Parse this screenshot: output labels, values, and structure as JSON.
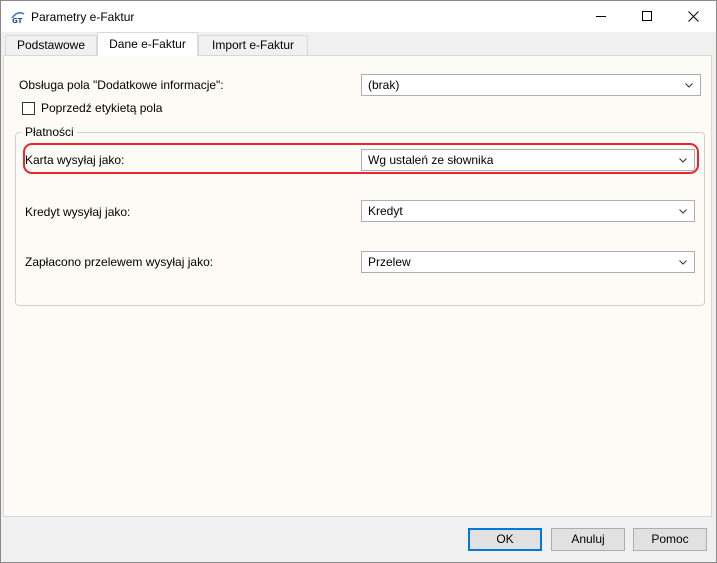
{
  "window": {
    "title": "Parametry e-Faktur",
    "icon": "app-logo-icon"
  },
  "tabs": [
    {
      "label": "Podstawowe",
      "active": false
    },
    {
      "label": "Dane e-Faktur",
      "active": true
    },
    {
      "label": "Import e-Faktur",
      "active": false
    }
  ],
  "form": {
    "extra_info_label": "Obsługa pola \"Dodatkowe informacje\":",
    "extra_info_value": "(brak)",
    "prefix_label_checkbox": "Poprzedź etykietą pola",
    "prefix_label_checked": false
  },
  "payments": {
    "group_title": "Płatności",
    "card_label": "Karta wysyłaj jako:",
    "card_value": "Wg ustaleń ze słownika",
    "credit_label": "Kredyt wysyłaj jako:",
    "credit_value": "Kredyt",
    "transfer_label": "Zapłacono przelewem wysyłaj jako:",
    "transfer_value": "Przelew"
  },
  "buttons": {
    "ok": "OK",
    "cancel": "Anuluj",
    "help": "Pomoc"
  },
  "colors": {
    "highlight": "#e8262b",
    "panel_background": "#fdfbf5",
    "default_button_border": "#0078d7"
  }
}
